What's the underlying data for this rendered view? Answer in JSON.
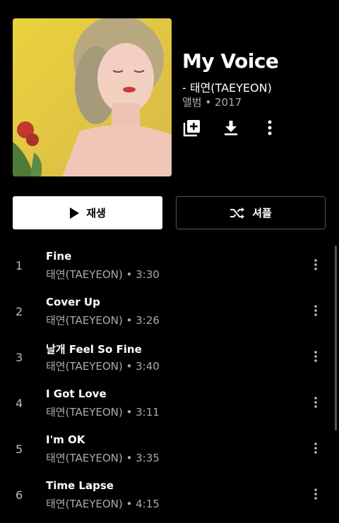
{
  "album": {
    "title": "My Voice",
    "artist": "- 태연(TAEYEON)",
    "meta": "앨범 • 2017"
  },
  "actions": {
    "add_icon": "library-add-icon",
    "download_icon": "download-icon",
    "more_icon": "more-vertical-icon"
  },
  "buttons": {
    "play_label": "재생",
    "shuffle_label": "셔플"
  },
  "tracks": [
    {
      "num": "1",
      "title": "Fine",
      "sub": "태연(TAEYEON) • 3:30"
    },
    {
      "num": "2",
      "title": "Cover Up",
      "sub": "태연(TAEYEON) • 3:26"
    },
    {
      "num": "3",
      "title": "날개 Feel So Fine",
      "sub": "태연(TAEYEON) • 3:40"
    },
    {
      "num": "4",
      "title": "I Got Love",
      "sub": "태연(TAEYEON) • 3:11"
    },
    {
      "num": "5",
      "title": "I'm OK",
      "sub": "태연(TAEYEON) • 3:35"
    },
    {
      "num": "6",
      "title": "Time Lapse",
      "sub": "태연(TAEYEON) • 4:15"
    }
  ],
  "colors": {
    "background": "#000000",
    "art_yellow": "#e4c64a",
    "secondary_text": "#aaaaaa"
  }
}
